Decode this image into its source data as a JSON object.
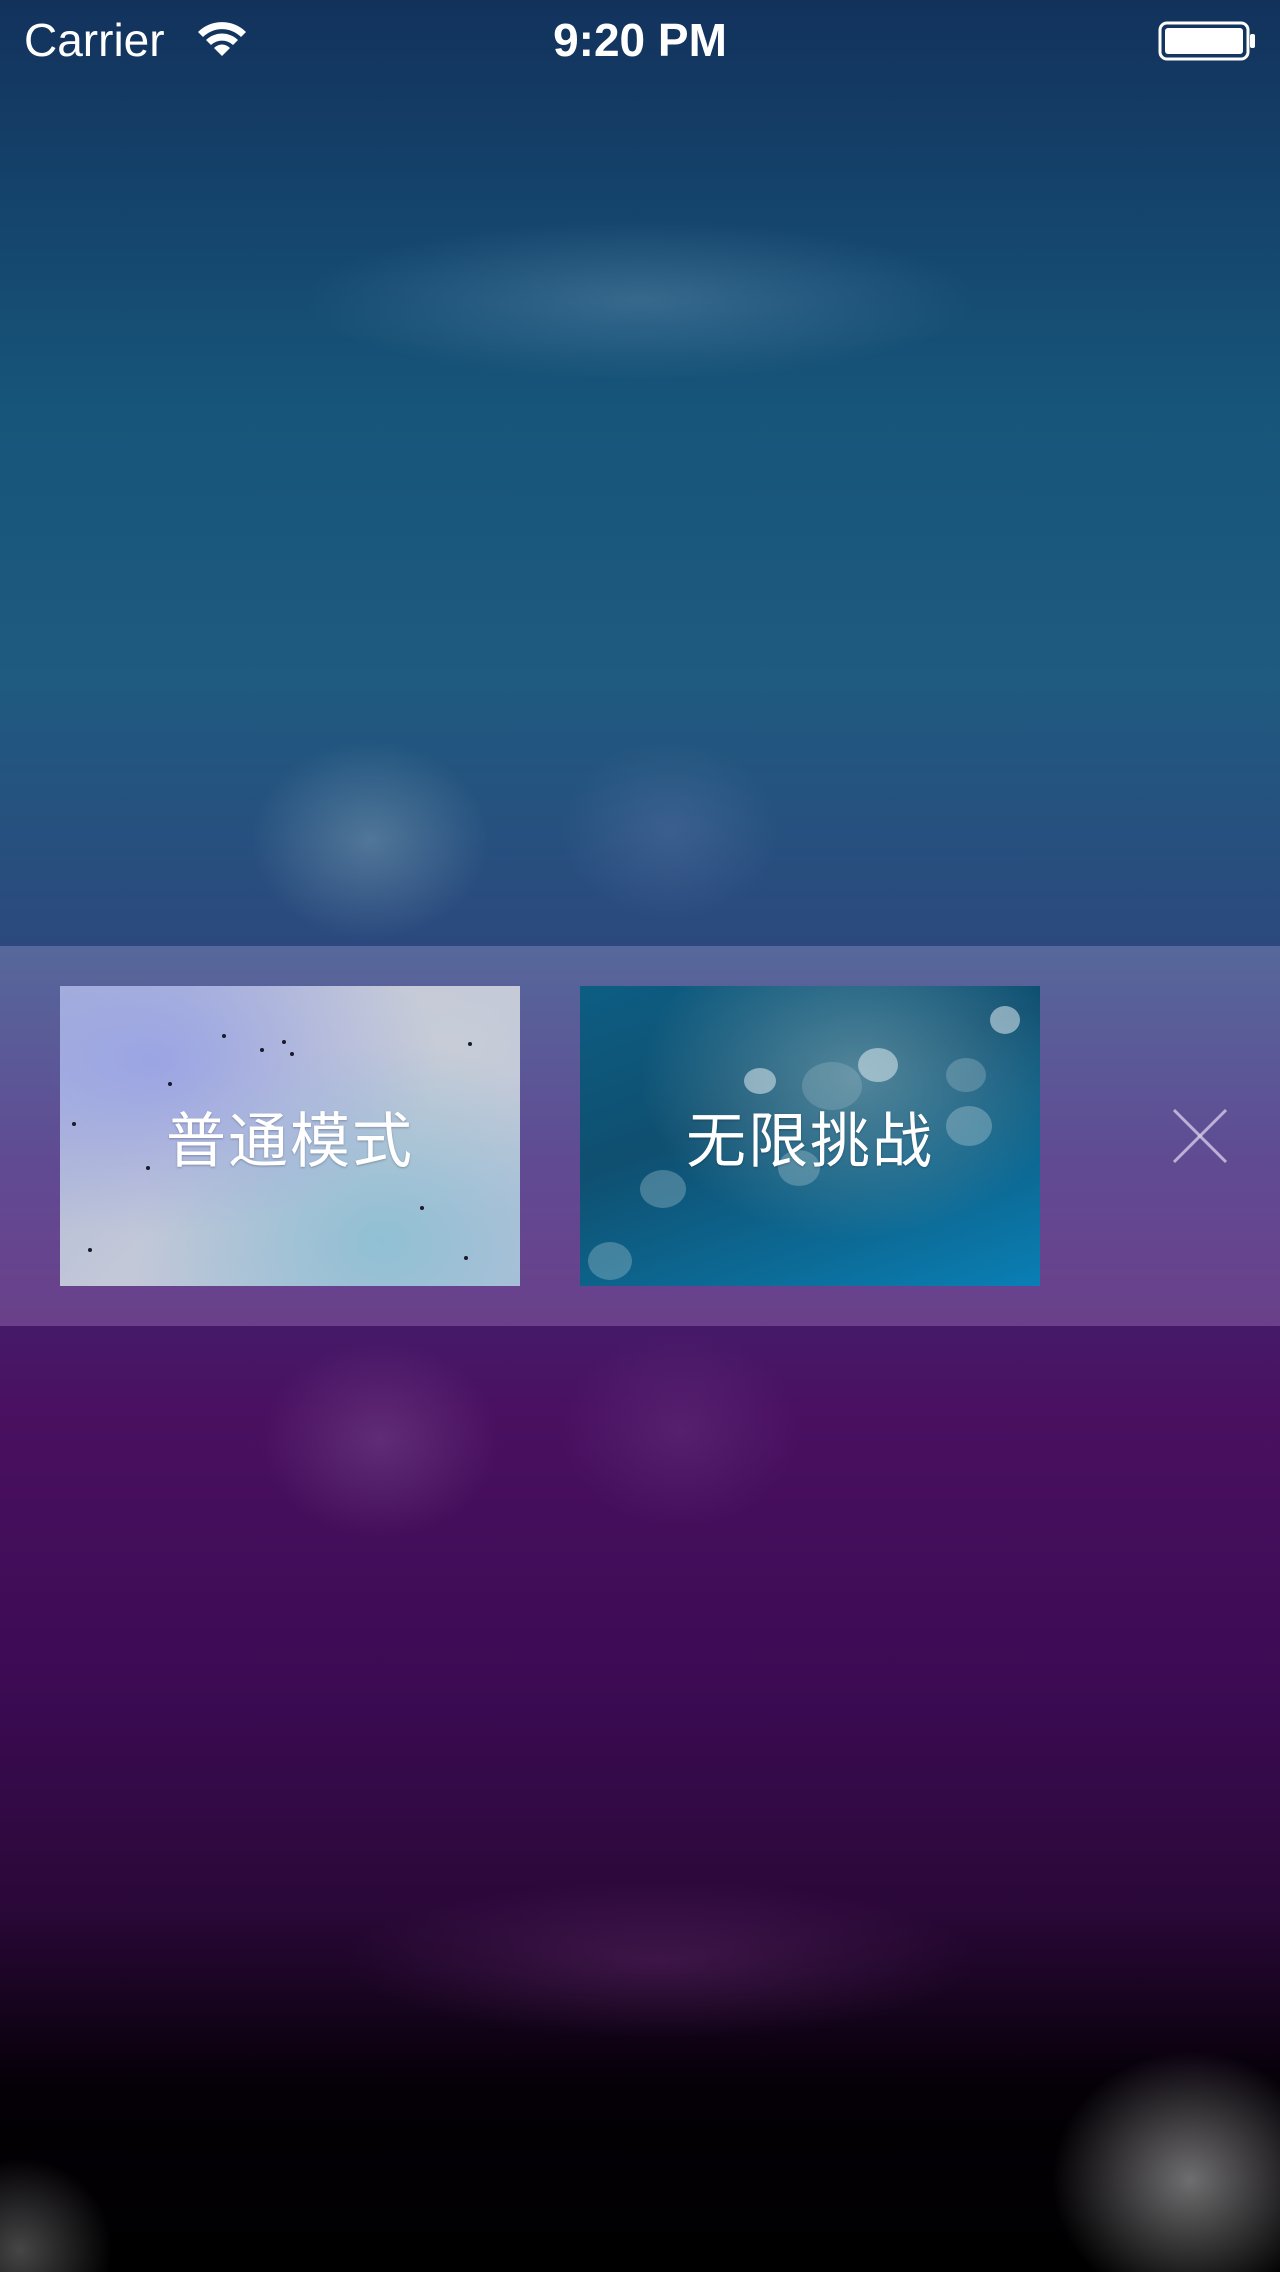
{
  "status_bar": {
    "carrier": "Carrier",
    "time": "9:20 PM",
    "wifi_icon": "wifi-icon",
    "battery_icon": "battery-icon"
  },
  "mode_selector": {
    "options": [
      {
        "label": "普通模式"
      },
      {
        "label": "无限挑战"
      }
    ],
    "close_icon": "close-icon"
  },
  "colors": {
    "background_top": "#12325c",
    "background_middle": "#4a1061",
    "background_bottom": "#000000",
    "band": "#7a6ab0",
    "text": "#ffffff"
  }
}
